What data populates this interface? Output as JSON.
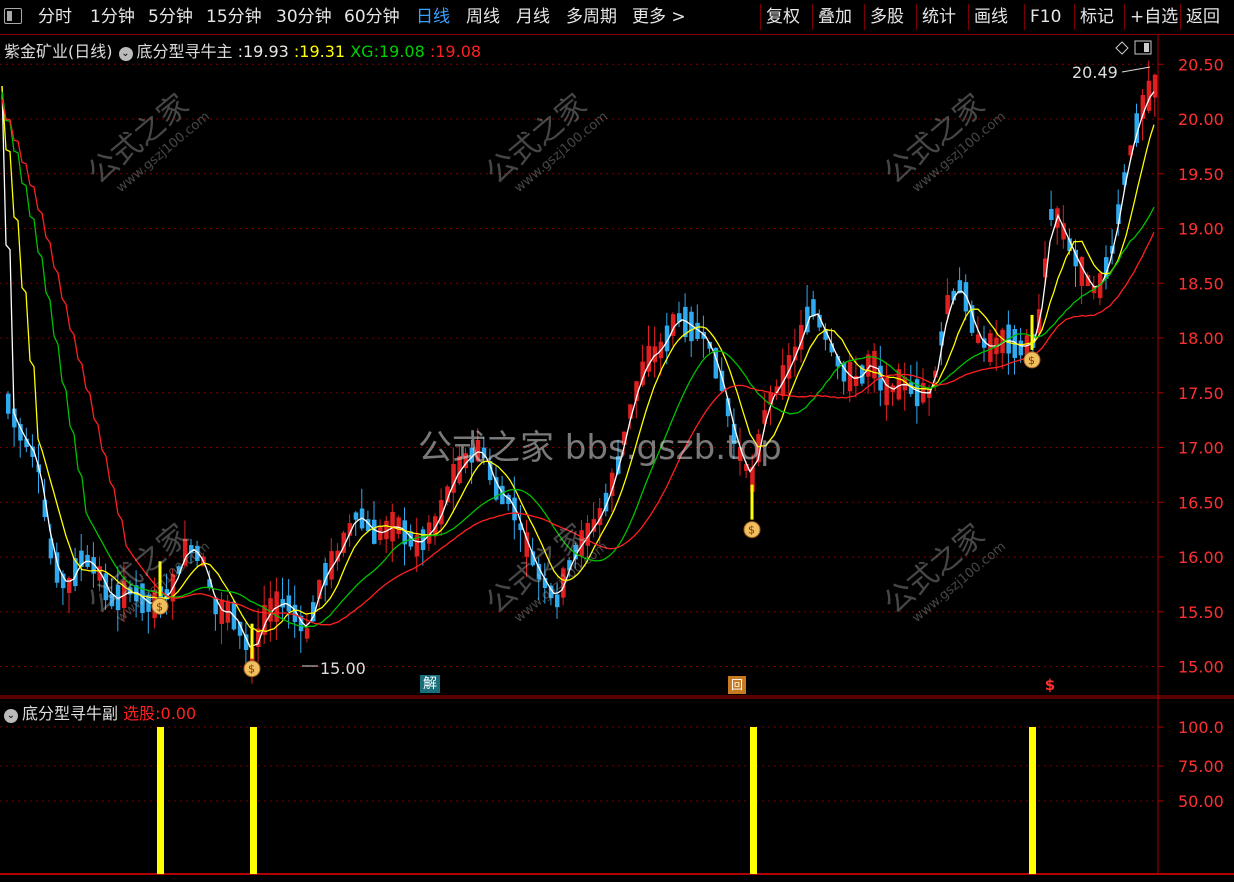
{
  "toolbar": {
    "left": [
      {
        "label": "分时",
        "active": false
      },
      {
        "label": "1分钟",
        "active": false
      },
      {
        "label": "5分钟",
        "active": false
      },
      {
        "label": "15分钟",
        "active": false
      },
      {
        "label": "30分钟",
        "active": false
      },
      {
        "label": "60分钟",
        "active": false
      },
      {
        "label": "日线",
        "active": true
      },
      {
        "label": "周线",
        "active": false
      },
      {
        "label": "月线",
        "active": false
      },
      {
        "label": "多周期",
        "active": false
      },
      {
        "label": "更多 >",
        "active": false
      }
    ],
    "right": [
      "复权",
      "叠加",
      "多股",
      "统计",
      "画线",
      "F10",
      "标记",
      "+自选",
      "返回"
    ]
  },
  "main": {
    "stock_name": "紫金矿业(日线)",
    "indicator_name": "底分型寻牛主",
    "white_value": "19.93",
    "yellow_value": "19.31",
    "xg_label": "XG:",
    "xg_value": "19.08",
    "red_value": "19.08",
    "high_label": "20.49",
    "low_label": "15.00",
    "price_axis": [
      "20.50",
      "20.00",
      "19.50",
      "19.00",
      "18.50",
      "18.00",
      "17.50",
      "17.00",
      "16.50",
      "16.00",
      "15.50",
      "15.00"
    ],
    "marker_jie": "解",
    "marker_hui": "回",
    "marker_s": "$"
  },
  "sub": {
    "indicator_name": "底分型寻牛副",
    "select_label": "选股:",
    "select_value": "0.00",
    "axis": [
      "100.0",
      "75.00",
      "50.00"
    ]
  },
  "watermark": {
    "small_text": "公式之家",
    "small_url": "www.gszj100.com",
    "center_text": "公式之家 bbs.gszb.top"
  },
  "chart_data": {
    "type": "candlestick",
    "description_values": {
      "price_range": [
        15.0,
        20.5
      ],
      "sub_range": [
        0,
        100
      ]
    },
    "signal_bars": [
      {
        "index": 5,
        "value": 100
      },
      {
        "index": 8,
        "value": 100
      },
      {
        "index": 25,
        "value": 100
      },
      {
        "index": 35,
        "value": 100
      }
    ],
    "colors": {
      "up": "#ff2020",
      "down": "#3ab0f0",
      "white_line": "#ffffff",
      "yellow_line": "#ffff00",
      "green_line": "#00c000",
      "red_line": "#ff2020",
      "signal": "#ffff00"
    }
  }
}
